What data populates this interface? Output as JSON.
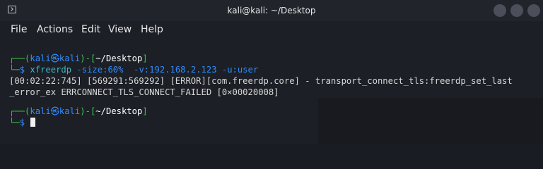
{
  "window": {
    "title": "kali@kali: ~/Desktop",
    "menu": [
      "File",
      "Actions",
      "Edit",
      "View",
      "Help"
    ]
  },
  "terminal": {
    "prompt1": {
      "top_left": "┌──(",
      "user": "kali",
      "at_symbol": "㉿",
      "host": "kali",
      "mid": ")-[",
      "path": "~/Desktop",
      "end": "]",
      "bottom_left": "└─",
      "dollar": "$ ",
      "command": "xfreerdp",
      "arg1": " -size:60%",
      "arg2": "  -v:192.168.2.123",
      "arg3": " -u:user"
    },
    "output_line1": "[00:02:22:745] [569291:569292] [ERROR][com.freerdp.core] - transport_connect_tls:freerdp_set_last",
    "output_line2": "_error_ex ERRCONNECT_TLS_CONNECT_FAILED [0×00020008]",
    "prompt2": {
      "top_left": "┌──(",
      "user": "kali",
      "at_symbol": "㉿",
      "host": "kali",
      "mid": ")-[",
      "path": "~/Desktop",
      "end": "]",
      "bottom_left": "└─",
      "dollar": "$ "
    }
  }
}
